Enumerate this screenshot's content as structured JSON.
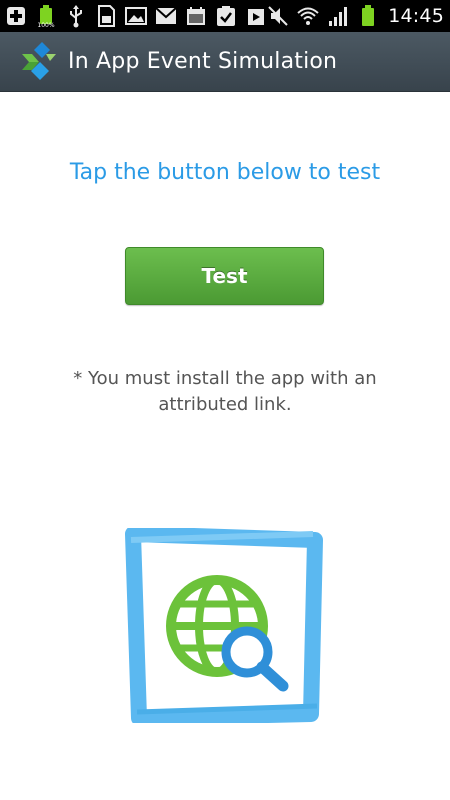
{
  "status_bar": {
    "battery_small_label": "100%",
    "time": "14:45",
    "left_icons": [
      "add-icon",
      "battery-icon",
      "usb-icon",
      "sd-card-icon",
      "image-icon",
      "gmail-icon",
      "calendar-icon",
      "task-check-icon",
      "play-store-icon"
    ],
    "right_icons": [
      "mute-icon",
      "wifi-icon",
      "signal-icon",
      "battery-icon"
    ]
  },
  "action_bar": {
    "title": "In App Event Simulation",
    "background": "#3f4b55"
  },
  "content": {
    "prompt": "Tap the button below to test",
    "prompt_color": "#2b9be6",
    "button_label": "Test",
    "button_color": "#5aab3e",
    "note_line1": "* You must install the app with an",
    "note_line2": "attributed link.",
    "illustration_icon": "globe-search-icon"
  }
}
